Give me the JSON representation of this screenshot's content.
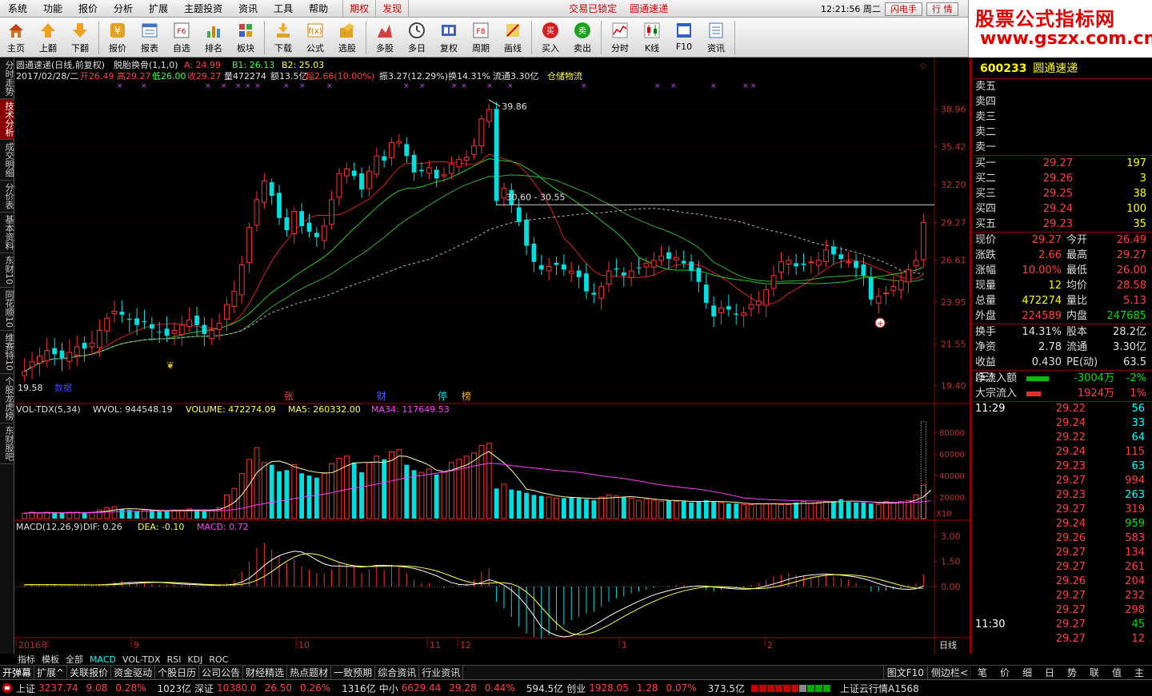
{
  "menu": {
    "items": [
      "系统",
      "功能",
      "报价",
      "分析",
      "扩展",
      "主题投资",
      "资讯",
      "工具",
      "帮助"
    ],
    "dotted": [
      false,
      false,
      false,
      false,
      false,
      true,
      false,
      false,
      false
    ],
    "tab_qiquan": "期权",
    "tab_faxian": "发现",
    "trade_locked": "交易已锁定",
    "current_stock": "圆通速递",
    "clock": "12:21:56 周二",
    "btn_flash": "闪电手",
    "btn_quote": "行  情"
  },
  "brand": {
    "line1": "股票公式指标网",
    "line2": "www.gszx.com.cn"
  },
  "toolbar": [
    {
      "label": "主页",
      "icon": "home-icon"
    },
    {
      "label": "上翻",
      "icon": "arrow-up-icon"
    },
    {
      "label": "下翻",
      "icon": "arrow-down-icon"
    },
    {
      "label": "报价",
      "icon": "yen-icon"
    },
    {
      "label": "报表",
      "icon": "report-icon"
    },
    {
      "label": "自选",
      "icon": "f6-icon"
    },
    {
      "label": "排名",
      "icon": "rank-icon"
    },
    {
      "label": "板块",
      "icon": "block-icon"
    },
    {
      "label": "下载",
      "icon": "download-icon"
    },
    {
      "label": "公式",
      "icon": "formula-icon"
    },
    {
      "label": "选股",
      "icon": "select-stock-icon"
    },
    {
      "label": "多股",
      "icon": "multi-stock-icon"
    },
    {
      "label": "多日",
      "icon": "multi-day-icon"
    },
    {
      "label": "复权",
      "icon": "restore-icon"
    },
    {
      "label": "周期",
      "icon": "f8-icon"
    },
    {
      "label": "画线",
      "icon": "draw-line-icon"
    },
    {
      "label": "买入",
      "icon": "buy-icon"
    },
    {
      "label": "卖出",
      "icon": "sell-icon"
    },
    {
      "label": "分时",
      "icon": "timeshare-icon"
    },
    {
      "label": "K线",
      "icon": "kline-icon"
    },
    {
      "label": "F10",
      "icon": "f10-icon"
    },
    {
      "label": "资讯",
      "icon": "news-icon"
    }
  ],
  "left_tabs": [
    "分时走势",
    "技术分析",
    "成交明细",
    "分价表",
    "基本资料",
    "东财10",
    "同花顺10",
    "维赛特10",
    "个股龙虎榜",
    "东财股吧"
  ],
  "left_tab_active": 1,
  "chart": {
    "title_name": "圆通速递(日线,前复权)",
    "title_indicator": "脱胎换骨(1,1,0)",
    "title_a": "A: 24.99",
    "title_b1": "B1: 26.13",
    "title_b2": "B2: 25.03",
    "info_date": "2017/02/28/二",
    "info_open": "开26.49",
    "info_high": "高29.27",
    "info_low": "低26.00",
    "info_close": "收29.27",
    "info_vol": "量472274",
    "info_amt": "额13.5亿",
    "info_chg": "幅2.66(10.00%)",
    "info_amp": "振3.27(12.29%)",
    "info_turn": "换14.31%",
    "info_float": "流通3.30亿",
    "info_sector": "仓储物流",
    "price_axis": [
      "38.96",
      "35.42",
      "32.20",
      "29.27",
      "26.61",
      "23.95",
      "21.55",
      "19.40"
    ],
    "peak_label": "39.86",
    "low_label": "19.58",
    "low_label_suffix": "数据",
    "range_label": "30.60 - 30.55",
    "event_labels": [
      "张",
      "财",
      "停",
      "榜"
    ],
    "vol_title": "VOL-TDX(5,34)",
    "vol_wvol": "WVOL: 944548.19",
    "vol_volume": "VOLUME: 472274.09",
    "vol_ma5": "MA5: 260332.00",
    "vol_ma34": "MA34: 117649.53",
    "vol_axis": [
      "80000",
      "60000",
      "40000",
      "20000"
    ],
    "vol_unit": "X10",
    "macd_title": "MACD(12,26,9)",
    "macd_dif": "DIF: 0.26",
    "macd_dea": "DEA: -0.10",
    "macd_macd": "MACD: 0.72",
    "macd_axis": [
      "3.00",
      "1.50",
      "0.00"
    ],
    "date_labels": [
      "2016年",
      "9",
      "10",
      "11",
      "12",
      "1",
      "2"
    ],
    "period_label": "日线"
  },
  "chart_data": {
    "type": "candlestick",
    "closes": [
      20.1,
      20.6,
      20.9,
      21.2,
      21.0,
      20.8,
      21.1,
      21.4,
      21.3,
      21.6,
      22.3,
      23.0,
      23.4,
      23.2,
      22.9,
      22.6,
      22.8,
      22.4,
      22.2,
      22.0,
      22.3,
      22.6,
      22.9,
      22.6,
      22.1,
      22.3,
      22.7,
      23.8,
      24.6,
      26.3,
      28.9,
      31.0,
      32.5,
      31.3,
      29.6,
      28.7,
      30.1,
      29.0,
      28.6,
      28.2,
      29.0,
      31.0,
      33.1,
      33.5,
      32.9,
      31.8,
      33.3,
      34.6,
      34.2,
      35.8,
      35.9,
      34.6,
      33.2,
      33.3,
      33.6,
      32.7,
      33.0,
      33.9,
      34.3,
      34.5,
      35.5,
      38.0,
      38.9,
      30.9,
      31.9,
      30.6,
      29.3,
      27.6,
      26.5,
      26.0,
      26.2,
      26.3,
      26.0,
      25.9,
      25.5,
      24.6,
      24.4,
      24.9,
      25.9,
      26.0,
      25.6,
      25.9,
      26.1,
      26.4,
      26.6,
      26.9,
      26.7,
      26.8,
      26.4,
      25.9,
      25.2,
      23.9,
      23.1,
      23.6,
      23.5,
      23.2,
      23.3,
      23.8,
      24.0,
      24.7,
      25.6,
      26.5,
      26.6,
      26.2,
      26.3,
      26.5,
      26.6,
      27.3,
      27.0,
      26.7,
      26.5,
      26.1,
      25.6,
      24.1,
      24.3,
      24.5,
      24.9,
      25.3,
      26.0,
      26.6,
      29.27
    ],
    "vol_values": [
      5,
      6,
      5,
      6,
      5,
      5,
      6,
      6,
      5,
      6,
      8,
      10,
      11,
      9,
      8,
      7,
      8,
      8,
      7,
      7,
      8,
      8,
      9,
      8,
      7,
      8,
      10,
      22,
      28,
      42,
      55,
      66,
      52,
      50,
      44,
      45,
      50,
      42,
      40,
      38,
      42,
      51,
      56,
      58,
      52,
      43,
      52,
      58,
      55,
      62,
      64,
      50,
      45,
      43,
      46,
      41,
      43,
      52,
      55,
      58,
      61,
      68,
      70,
      28,
      32,
      27,
      26,
      24,
      22,
      21,
      20,
      19,
      19,
      20,
      19,
      18,
      17,
      20,
      22,
      21,
      20,
      19,
      17,
      18,
      17,
      16,
      17,
      16,
      16,
      15,
      16,
      17,
      16,
      15,
      14,
      14,
      13,
      13,
      14,
      14,
      14,
      13,
      13,
      15,
      16,
      14,
      15,
      16,
      16,
      18,
      16,
      15,
      15,
      14,
      13,
      16,
      15,
      16,
      17,
      22,
      31,
      46
    ],
    "macd_values": [
      0.1,
      0.1,
      0.1,
      0.1,
      0.1,
      0.05,
      0.05,
      0.1,
      0.1,
      0.1,
      0.15,
      0.2,
      0.3,
      0.35,
      0.3,
      0.2,
      0.2,
      0.15,
      0.1,
      0.1,
      0.1,
      0.1,
      0.1,
      0.05,
      0.0,
      0.05,
      0.1,
      0.2,
      0.4,
      0.9,
      1.5,
      2.3,
      2.6,
      2.2,
      1.8,
      1.4,
      1.6,
      1.2,
      1.0,
      0.8,
      0.8,
      1.0,
      1.4,
      1.4,
      1.2,
      0.8,
      1.0,
      1.2,
      1.0,
      1.3,
      1.2,
      0.8,
      0.4,
      0.2,
      0.2,
      0.0,
      -0.1,
      0.0,
      0.1,
      0.2,
      0.4,
      0.9,
      1.1,
      -0.9,
      -1.3,
      -1.8,
      -2.4,
      -2.8,
      -3.0,
      -3.1,
      -2.9,
      -2.6,
      -2.3,
      -2.0,
      -1.8,
      -1.6,
      -1.5,
      -1.2,
      -0.9,
      -0.7,
      -0.6,
      -0.4,
      -0.3,
      -0.2,
      -0.1,
      0.0,
      0.05,
      0.1,
      0.1,
      0.05,
      0.0,
      -0.2,
      -0.3,
      -0.2,
      -0.15,
      -0.1,
      -0.05,
      0.1,
      0.2,
      0.4,
      0.6,
      0.7,
      0.8,
      0.7,
      0.6,
      0.6,
      0.6,
      0.7,
      0.6,
      0.5,
      0.4,
      0.2,
      0.0,
      -0.3,
      -0.3,
      -0.25,
      -0.2,
      -0.1,
      0.1,
      0.2,
      0.72
    ]
  },
  "right": {
    "code": "600233",
    "name": "圆通速递",
    "sell_labels": [
      "卖五",
      "卖四",
      "卖三",
      "卖二",
      "卖一"
    ],
    "buy": [
      {
        "k": "买一",
        "p": "29.27",
        "q": "197"
      },
      {
        "k": "买二",
        "p": "29.26",
        "q": "3"
      },
      {
        "k": "买三",
        "p": "29.25",
        "q": "38"
      },
      {
        "k": "买四",
        "p": "29.24",
        "q": "100"
      },
      {
        "k": "买五",
        "p": "29.23",
        "q": "35"
      }
    ],
    "stats": [
      {
        "k1": "现价",
        "v1": "29.27",
        "c1": "red",
        "k2": "今开",
        "v2": "26.49",
        "c2": "red"
      },
      {
        "k1": "涨跌",
        "v1": "2.66",
        "c1": "red",
        "k2": "最高",
        "v2": "29.27",
        "c2": "red"
      },
      {
        "k1": "涨幅",
        "v1": "10.00%",
        "c1": "red",
        "k2": "最低",
        "v2": "26.00",
        "c2": "red"
      },
      {
        "k1": "现量",
        "v1": "12",
        "c1": "yel",
        "k2": "均价",
        "v2": "28.58",
        "c2": "red"
      },
      {
        "k1": "总量",
        "v1": "472274",
        "c1": "yel",
        "k2": "量比",
        "v2": "5.13",
        "c2": "red"
      },
      {
        "k1": "外盘",
        "v1": "224589",
        "c1": "red",
        "k2": "内盘",
        "v2": "247685",
        "c2": "grn"
      }
    ],
    "stats2": [
      {
        "k1": "换手",
        "v1": "14.31%",
        "k2": "股本",
        "v2": "28.2亿"
      },
      {
        "k1": "净资",
        "v1": "2.78",
        "k2": "流通",
        "v2": "3.30亿"
      },
      {
        "k1": "收益(三)",
        "v1": "0.430",
        "k2": "PE(动)",
        "v2": "63.5"
      }
    ],
    "flow": [
      {
        "k": "净流入额",
        "v": "-3004万",
        "p": "-2%",
        "color": "#00c000",
        "bar": 0.55
      },
      {
        "k": "大宗流入",
        "v": "1924万",
        "p": "1%",
        "color": "#e03030",
        "bar": 0.35
      }
    ],
    "ticks_head_time": "11:29",
    "ticks": [
      {
        "p": "29.22",
        "v": "56",
        "c": "cyan"
      },
      {
        "p": "29.24",
        "v": "33",
        "c": "cyan"
      },
      {
        "p": "29.22",
        "v": "64",
        "c": "cyan"
      },
      {
        "p": "29.24",
        "v": "115",
        "c": "red"
      },
      {
        "p": "29.23",
        "v": "63",
        "c": "cyan"
      },
      {
        "p": "29.27",
        "v": "994",
        "c": "red"
      },
      {
        "p": "29.23",
        "v": "263",
        "c": "cyan"
      },
      {
        "p": "29.27",
        "v": "319",
        "c": "red"
      },
      {
        "p": "29.24",
        "v": "959",
        "c": "grn"
      },
      {
        "p": "29.26",
        "v": "583",
        "c": "red"
      },
      {
        "p": "29.27",
        "v": "134",
        "c": "red"
      },
      {
        "p": "29.27",
        "v": "261",
        "c": "red"
      },
      {
        "p": "29.26",
        "v": "204",
        "c": "red"
      },
      {
        "p": "29.27",
        "v": "232",
        "c": "red"
      },
      {
        "p": "29.27",
        "v": "298",
        "c": "red"
      }
    ],
    "ticks2_time": "11:30",
    "ticks2": [
      {
        "p": "29.27",
        "v": "45",
        "c": "grn"
      },
      {
        "p": "29.27",
        "v": "12",
        "c": "red"
      }
    ]
  },
  "bottom_tabs": [
    "指标",
    "模板",
    "全部",
    "MACD",
    "VOL-TDX",
    "RSI",
    "KDJ",
    "ROC"
  ],
  "bottom_tab_active": 3,
  "func_tabs": [
    "开弹幕",
    "扩展^",
    "关联报价",
    "资金驱动",
    "个股日历",
    "公司公告",
    "财经精选",
    "热点题材",
    "一致预期",
    "综合资讯",
    "行业资讯"
  ],
  "func_right": [
    "图文F10",
    "侧边栏<"
  ],
  "right_tabs": [
    "笔",
    "价",
    "细",
    "日",
    "势",
    "联",
    "值",
    "主"
  ],
  "status": {
    "sh_label": "上证",
    "sh_val": "3237.74",
    "sh_chg": "9.08",
    "sh_pct": "0.28%",
    "sh_amt": "1023亿",
    "sz_label": "深证",
    "sz_val": "10380.0",
    "sz_chg": "26.50",
    "sz_pct": "0.26%",
    "sz_amt": "1316亿",
    "zx_label": "中小",
    "zx_val": "6629.44",
    "zx_chg": "29.28",
    "zx_pct": "0.44%",
    "zx_amt": "594.5亿",
    "cy_label": "创业",
    "cy_val": "1928.05",
    "cy_chg": "1.28",
    "cy_pct": "0.07%",
    "cy_amt": "373.5亿",
    "server": "上证云行情A1568"
  }
}
